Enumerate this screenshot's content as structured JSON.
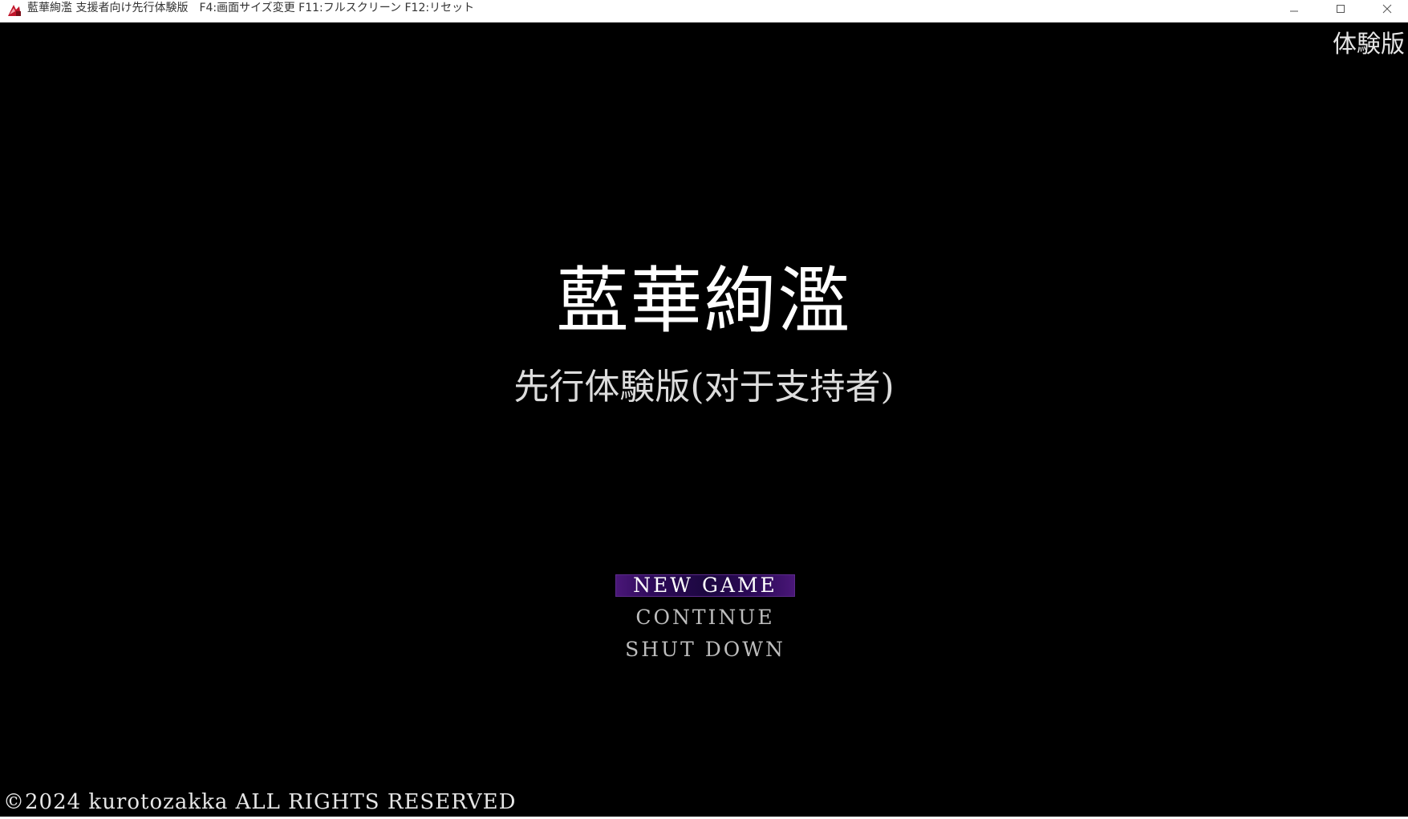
{
  "window": {
    "title": "藍華絢濫 支援者向け先行体験版　F4:画面サイズ変更 F11:フルスクリーン F12:リセット"
  },
  "game": {
    "corner_label": "体験版",
    "title": "藍華絢濫",
    "subtitle": "先行体験版(对于支持者)",
    "menu": [
      {
        "label": "NEW GAME",
        "selected": true
      },
      {
        "label": "CONTINUE",
        "selected": false
      },
      {
        "label": "SHUT DOWN",
        "selected": false
      }
    ],
    "copyright": "©2024 kurotozakka ALL RIGHTS RESERVED"
  },
  "colors": {
    "background": "#000000",
    "menu_highlight": "#2e0a5a",
    "text": "#ffffff"
  }
}
